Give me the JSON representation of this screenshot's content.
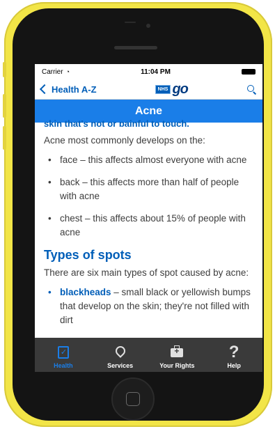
{
  "status_bar": {
    "carrier": "Carrier",
    "time": "11:04 PM"
  },
  "nav": {
    "back_label": "Health A-Z",
    "logo_badge": "NHS",
    "logo_text": "go"
  },
  "title": "Acne",
  "content": {
    "partial_line": "skin that's not or painful to touch.",
    "intro": "Acne most commonly develops on the:",
    "bullets": [
      "face – this affects almost everyone with acne",
      "back – this affects more than half of people with acne",
      "chest – this affects about 15% of people with acne"
    ],
    "heading": "Types of spots",
    "types_intro": "There are six main types of spot caused by acne:",
    "type_item": {
      "link": "blackheads",
      "text": " – small black or yellowish bumps that develop on the skin; they're not filled with dirt"
    }
  },
  "tabs": [
    {
      "label": "Health",
      "icon": "clipboard-check-icon",
      "active": true
    },
    {
      "label": "Services",
      "icon": "location-pin-icon",
      "active": false
    },
    {
      "label": "Your Rights",
      "icon": "briefcase-icon",
      "active": false
    },
    {
      "label": "Help",
      "icon": "question-icon",
      "active": false
    }
  ],
  "colors": {
    "phone": "#f2e547",
    "accent": "#005eb8",
    "title_bar": "#1a7ee8",
    "tab_bar": "#3a3a3a"
  }
}
